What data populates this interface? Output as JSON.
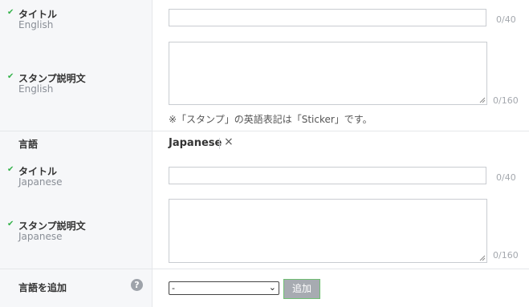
{
  "sections": {
    "title_en": {
      "check": "✔",
      "label": "タイトル",
      "sub": "English",
      "counter": "0/40"
    },
    "desc_en": {
      "check": "✔",
      "label": "スタンプ説明文",
      "sub": "English",
      "counter": "0/160"
    },
    "note": "※「スタンプ」の英語表記は「Sticker」です。",
    "language": {
      "label": "言語",
      "value": "Japanese",
      "remove": "×"
    },
    "title_ja": {
      "check": "✔",
      "label": "タイトル",
      "sub": "Japanese",
      "counter": "0/40"
    },
    "desc_ja": {
      "check": "✔",
      "label": "スタンプ説明文",
      "sub": "Japanese",
      "counter": "0/160"
    },
    "add_language": {
      "label": "言語を追加",
      "help": "?",
      "select_value": "-",
      "button": "追加"
    }
  }
}
